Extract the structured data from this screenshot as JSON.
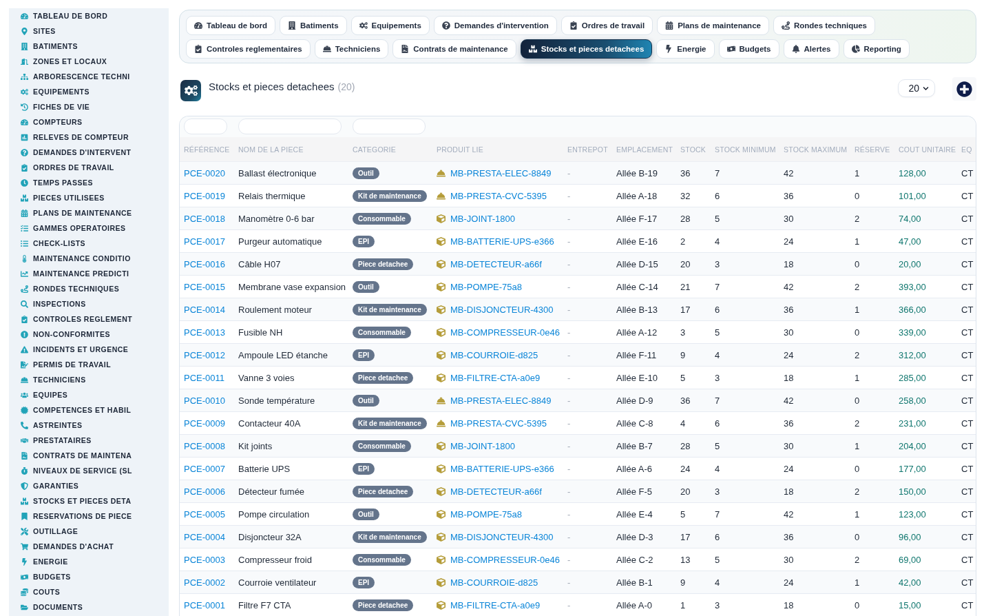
{
  "sidebar": {
    "items": [
      "TABLEAU DE BORD",
      "SITES",
      "BATIMENTS",
      "ZONES ET LOCAUX",
      "ARBORESCENCE TECHNI",
      "EQUIPEMENTS",
      "FICHES DE VIE",
      "COMPTEURS",
      "RELEVES DE COMPTEUR",
      "DEMANDES D'INTERVENT",
      "ORDRES DE TRAVAIL",
      "TEMPS PASSES",
      "PIECES UTILISEES",
      "PLANS DE MAINTENANCE",
      "GAMMES OPERATOIRES",
      "CHECK-LISTS",
      "MAINTENANCE CONDITIO",
      "MAINTENANCE PREDICTI",
      "RONDES TECHNIQUES",
      "INSPECTIONS",
      "CONTROLES REGLEMENT",
      "NON-CONFORMITES",
      "INCIDENTS ET URGENCE",
      "PERMIS DE TRAVAIL",
      "TECHNICIENS",
      "EQUIPES",
      "COMPETENCES ET HABIL",
      "ASTREINTES",
      "PRESTATAIRES",
      "CONTRATS DE MAINTENA",
      "NIVEAUX DE SERVICE (SL",
      "GARANTIES",
      "STOCKS ET PIECES DETA",
      "RESERVATIONS DE PIECE",
      "OUTILLAGE",
      "DEMANDES D'ACHAT",
      "ENERGIE",
      "BUDGETS",
      "COUTS",
      "DOCUMENTS"
    ]
  },
  "tabs": [
    {
      "label": "Tableau de bord",
      "selected": false
    },
    {
      "label": "Batiments",
      "selected": false
    },
    {
      "label": "Equipements",
      "selected": false
    },
    {
      "label": "Demandes d'intervention",
      "selected": false
    },
    {
      "label": "Ordres de travail",
      "selected": false
    },
    {
      "label": "Plans de maintenance",
      "selected": false
    },
    {
      "label": "Rondes techniques",
      "selected": false
    },
    {
      "label": "Controles reglementaires",
      "selected": false
    },
    {
      "label": "Techniciens",
      "selected": false
    },
    {
      "label": "Contrats de maintenance",
      "selected": false
    },
    {
      "label": "Stocks et pieces detachees",
      "selected": true
    },
    {
      "label": "Energie",
      "selected": false
    },
    {
      "label": "Budgets",
      "selected": false
    },
    {
      "label": "Alertes",
      "selected": false
    },
    {
      "label": "Reporting",
      "selected": false
    }
  ],
  "header": {
    "title": "Stocks et pieces detachees",
    "count": "(20)",
    "page_size": "20"
  },
  "table": {
    "columns": [
      {
        "label": "RÉFÉRENCE",
        "filter": true
      },
      {
        "label": "NOM DE LA PIECE",
        "filter": true
      },
      {
        "label": "CATEGORIE",
        "filter": true
      },
      {
        "label": "PRODUIT LIE",
        "filter": false
      },
      {
        "label": "ENTREPOT",
        "filter": false
      },
      {
        "label": "EMPLACEMENT",
        "filter": false
      },
      {
        "label": "STOCK",
        "filter": false
      },
      {
        "label": "STOCK MINIMUM",
        "filter": false
      },
      {
        "label": "STOCK MAXIMUM",
        "filter": false
      },
      {
        "label": "RÉSERVE",
        "filter": false
      },
      {
        "label": "COUT UNITAIRE",
        "filter": false
      },
      {
        "label": "EQ",
        "filter": false
      }
    ],
    "rows": [
      {
        "reference": "PCE-0020",
        "name": "Ballast électronique",
        "category": "Outil",
        "product": {
          "kind": "service",
          "label": "MB-PRESTA-ELEC-8849"
        },
        "warehouse": "-",
        "location": "Allée B-19",
        "stock": "36",
        "stock_min": "7",
        "stock_max": "42",
        "reserved": "1",
        "unit_cost": "128,00",
        "column_12": "CT"
      },
      {
        "reference": "PCE-0019",
        "name": "Relais thermique",
        "category": "Kit de maintenance",
        "product": {
          "kind": "service",
          "label": "MB-PRESTA-CVC-5395"
        },
        "warehouse": "-",
        "location": "Allée A-18",
        "stock": "32",
        "stock_min": "6",
        "stock_max": "36",
        "reserved": "0",
        "unit_cost": "101,00",
        "column_12": "CT"
      },
      {
        "reference": "PCE-0018",
        "name": "Manomètre 0-6 bar",
        "category": "Consommable",
        "product": {
          "kind": "part",
          "label": "MB-JOINT-1800"
        },
        "warehouse": "-",
        "location": "Allée F-17",
        "stock": "28",
        "stock_min": "5",
        "stock_max": "30",
        "reserved": "2",
        "unit_cost": "74,00",
        "column_12": "CT"
      },
      {
        "reference": "PCE-0017",
        "name": "Purgeur automatique",
        "category": "EPI",
        "product": {
          "kind": "part",
          "label": "MB-BATTERIE-UPS-e366"
        },
        "warehouse": "-",
        "location": "Allée E-16",
        "stock": "2",
        "stock_min": "4",
        "stock_max": "24",
        "reserved": "1",
        "unit_cost": "47,00",
        "column_12": "CT"
      },
      {
        "reference": "PCE-0016",
        "name": "Câble H07",
        "category": "Piece detachee",
        "product": {
          "kind": "part",
          "label": "MB-DETECTEUR-a66f"
        },
        "warehouse": "-",
        "location": "Allée D-15",
        "stock": "20",
        "stock_min": "3",
        "stock_max": "18",
        "reserved": "0",
        "unit_cost": "20,00",
        "column_12": "CT"
      },
      {
        "reference": "PCE-0015",
        "name": "Membrane vase expansion",
        "category": "Outil",
        "product": {
          "kind": "part",
          "label": "MB-POMPE-75a8"
        },
        "warehouse": "-",
        "location": "Allée C-14",
        "stock": "21",
        "stock_min": "7",
        "stock_max": "42",
        "reserved": "2",
        "unit_cost": "393,00",
        "column_12": "CT"
      },
      {
        "reference": "PCE-0014",
        "name": "Roulement moteur",
        "category": "Kit de maintenance",
        "product": {
          "kind": "part",
          "label": "MB-DISJONCTEUR-4300"
        },
        "warehouse": "-",
        "location": "Allée B-13",
        "stock": "17",
        "stock_min": "6",
        "stock_max": "36",
        "reserved": "1",
        "unit_cost": "366,00",
        "column_12": "CT"
      },
      {
        "reference": "PCE-0013",
        "name": "Fusible NH",
        "category": "Consommable",
        "product": {
          "kind": "part",
          "label": "MB-COMPRESSEUR-0e46"
        },
        "warehouse": "-",
        "location": "Allée A-12",
        "stock": "3",
        "stock_min": "5",
        "stock_max": "30",
        "reserved": "0",
        "unit_cost": "339,00",
        "column_12": "CT"
      },
      {
        "reference": "PCE-0012",
        "name": "Ampoule LED étanche",
        "category": "EPI",
        "product": {
          "kind": "part",
          "label": "MB-COURROIE-d825"
        },
        "warehouse": "-",
        "location": "Allée F-11",
        "stock": "9",
        "stock_min": "4",
        "stock_max": "24",
        "reserved": "2",
        "unit_cost": "312,00",
        "column_12": "CT"
      },
      {
        "reference": "PCE-0011",
        "name": "Vanne 3 voies",
        "category": "Piece detachee",
        "product": {
          "kind": "part",
          "label": "MB-FILTRE-CTA-a0e9"
        },
        "warehouse": "-",
        "location": "Allée E-10",
        "stock": "5",
        "stock_min": "3",
        "stock_max": "18",
        "reserved": "1",
        "unit_cost": "285,00",
        "column_12": "CT"
      },
      {
        "reference": "PCE-0010",
        "name": "Sonde température",
        "category": "Outil",
        "product": {
          "kind": "service",
          "label": "MB-PRESTA-ELEC-8849"
        },
        "warehouse": "-",
        "location": "Allée D-9",
        "stock": "36",
        "stock_min": "7",
        "stock_max": "42",
        "reserved": "0",
        "unit_cost": "258,00",
        "column_12": "CT"
      },
      {
        "reference": "PCE-0009",
        "name": "Contacteur 40A",
        "category": "Kit de maintenance",
        "product": {
          "kind": "service",
          "label": "MB-PRESTA-CVC-5395"
        },
        "warehouse": "-",
        "location": "Allée C-8",
        "stock": "4",
        "stock_min": "6",
        "stock_max": "36",
        "reserved": "2",
        "unit_cost": "231,00",
        "column_12": "CT"
      },
      {
        "reference": "PCE-0008",
        "name": "Kit joints",
        "category": "Consommable",
        "product": {
          "kind": "part",
          "label": "MB-JOINT-1800"
        },
        "warehouse": "-",
        "location": "Allée B-7",
        "stock": "28",
        "stock_min": "5",
        "stock_max": "30",
        "reserved": "1",
        "unit_cost": "204,00",
        "column_12": "CT"
      },
      {
        "reference": "PCE-0007",
        "name": "Batterie UPS",
        "category": "EPI",
        "product": {
          "kind": "part",
          "label": "MB-BATTERIE-UPS-e366"
        },
        "warehouse": "-",
        "location": "Allée A-6",
        "stock": "24",
        "stock_min": "4",
        "stock_max": "24",
        "reserved": "0",
        "unit_cost": "177,00",
        "column_12": "CT"
      },
      {
        "reference": "PCE-0006",
        "name": "Détecteur fumée",
        "category": "Piece detachee",
        "product": {
          "kind": "part",
          "label": "MB-DETECTEUR-a66f"
        },
        "warehouse": "-",
        "location": "Allée F-5",
        "stock": "20",
        "stock_min": "3",
        "stock_max": "18",
        "reserved": "2",
        "unit_cost": "150,00",
        "column_12": "CT"
      },
      {
        "reference": "PCE-0005",
        "name": "Pompe circulation",
        "category": "Outil",
        "product": {
          "kind": "part",
          "label": "MB-POMPE-75a8"
        },
        "warehouse": "-",
        "location": "Allée E-4",
        "stock": "5",
        "stock_min": "7",
        "stock_max": "42",
        "reserved": "1",
        "unit_cost": "123,00",
        "column_12": "CT"
      },
      {
        "reference": "PCE-0004",
        "name": "Disjoncteur 32A",
        "category": "Kit de maintenance",
        "product": {
          "kind": "part",
          "label": "MB-DISJONCTEUR-4300"
        },
        "warehouse": "-",
        "location": "Allée D-3",
        "stock": "17",
        "stock_min": "6",
        "stock_max": "36",
        "reserved": "0",
        "unit_cost": "96,00",
        "column_12": "CT"
      },
      {
        "reference": "PCE-0003",
        "name": "Compresseur froid",
        "category": "Consommable",
        "product": {
          "kind": "part",
          "label": "MB-COMPRESSEUR-0e46"
        },
        "warehouse": "-",
        "location": "Allée C-2",
        "stock": "13",
        "stock_min": "5",
        "stock_max": "30",
        "reserved": "2",
        "unit_cost": "69,00",
        "column_12": "CT"
      },
      {
        "reference": "PCE-0002",
        "name": "Courroie ventilateur",
        "category": "EPI",
        "product": {
          "kind": "part",
          "label": "MB-COURROIE-d825"
        },
        "warehouse": "-",
        "location": "Allée B-1",
        "stock": "9",
        "stock_min": "4",
        "stock_max": "24",
        "reserved": "1",
        "unit_cost": "42,00",
        "column_12": "CT"
      },
      {
        "reference": "PCE-0001",
        "name": "Filtre F7 CTA",
        "category": "Piece detachee",
        "product": {
          "kind": "part",
          "label": "MB-FILTRE-CTA-a0e9"
        },
        "warehouse": "-",
        "location": "Allée A-0",
        "stock": "1",
        "stock_min": "3",
        "stock_max": "18",
        "reserved": "0",
        "unit_cost": "15,00",
        "column_12": "CT"
      }
    ]
  }
}
